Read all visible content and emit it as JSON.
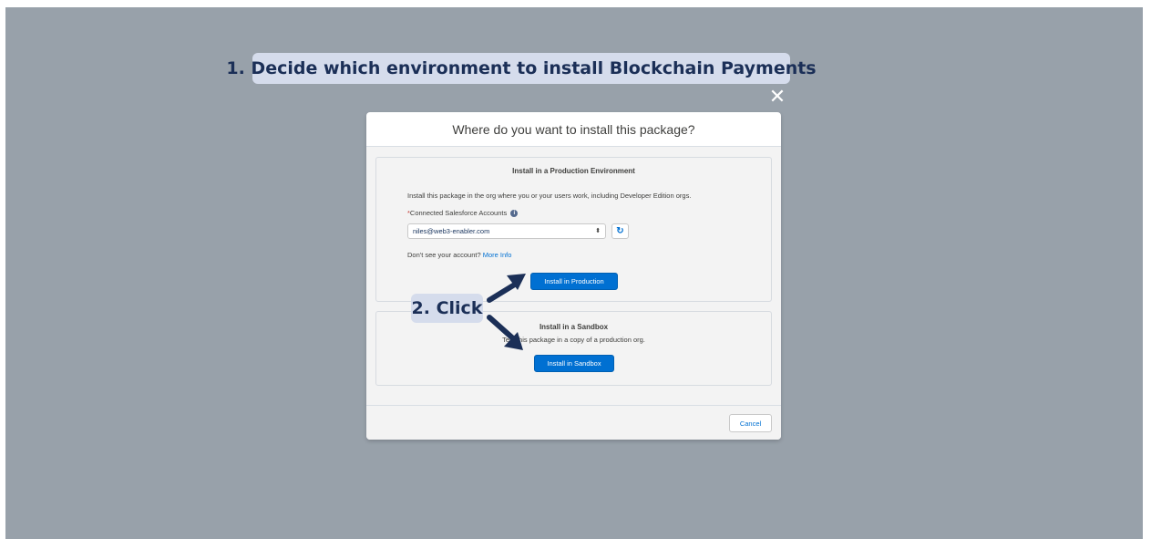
{
  "annotations": {
    "step1": "1. Decide which environment to install Blockchain Payments",
    "step2": "2. Click"
  },
  "modal": {
    "close_glyph": "✕",
    "title": "Where do you want to install this package?",
    "production": {
      "title": "Install in a Production Environment",
      "description": "Install this package in the org where you or your users work, including Developer Edition orgs.",
      "required_marker": "*",
      "accounts_label": "Connected Salesforce Accounts",
      "info_glyph": "i",
      "selected_account": "niles@web3-enabler.com",
      "select_arrows": "⬍",
      "refresh_glyph": "↻",
      "missing_account_text": "Don't see your account?",
      "more_info_link": "More Info",
      "install_button": "Install in Production"
    },
    "sandbox": {
      "title": "Install in a Sandbox",
      "description": "Test this package in a copy of a production org.",
      "install_button": "Install in Sandbox"
    },
    "cancel_button": "Cancel"
  },
  "colors": {
    "backdrop": "#98a1aa",
    "annotation_bg": "#d5dcec",
    "annotation_text": "#1b2f57",
    "brand_blue": "#0070d2",
    "arrow": "#1b2f57"
  },
  "icons": [
    "close-icon",
    "info-icon",
    "select-arrows-icon",
    "refresh-icon",
    "arrow-icon"
  ]
}
